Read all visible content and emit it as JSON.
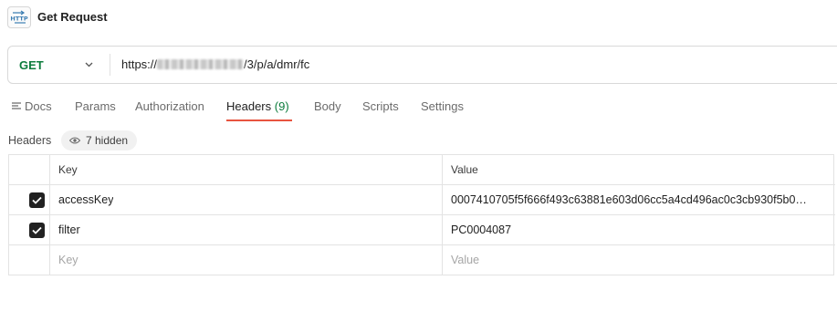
{
  "request": {
    "icon_label": "HTTP",
    "title": "Get Request"
  },
  "urlbar": {
    "method": "GET",
    "url_prefix": "https://",
    "url_suffix": "/3/p/a/dmr/fc"
  },
  "tabs": [
    {
      "label": "Docs"
    },
    {
      "label": "Params"
    },
    {
      "label": "Authorization"
    },
    {
      "label": "Headers",
      "count": "(9)"
    },
    {
      "label": "Body"
    },
    {
      "label": "Scripts"
    },
    {
      "label": "Settings"
    }
  ],
  "headers_section": {
    "label": "Headers",
    "hidden_pill": "7 hidden"
  },
  "table": {
    "columns": [
      "Key",
      "Value"
    ],
    "rows": [
      {
        "checked": true,
        "key": "accessKey",
        "value": "0007410705f5f666f493c63881e603d06cc5a4cd496ac0c3cb930f5b0…"
      },
      {
        "checked": true,
        "key": "filter",
        "value": "PC0004087"
      }
    ],
    "placeholder_key": "Key",
    "placeholder_value": "Value"
  },
  "colors": {
    "method_green": "#0c7c3c",
    "active_tab_underline": "#e8543f",
    "count_green": "#0c7c3c"
  }
}
